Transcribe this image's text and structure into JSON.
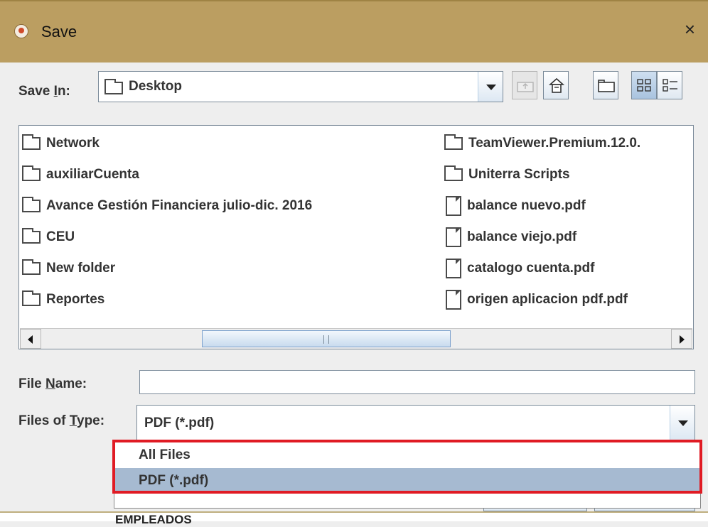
{
  "window": {
    "title": "Save",
    "close_glyph": "×"
  },
  "save_in": {
    "label_pre": "Save ",
    "label_mnemonic": "I",
    "label_post": "n:",
    "value": "Desktop"
  },
  "toolbar": {
    "buttons": [
      {
        "name": "up-one-level-icon",
        "enabled": false
      },
      {
        "name": "home-icon",
        "enabled": true
      },
      {
        "name": "new-folder-icon",
        "enabled": true
      },
      {
        "name": "list-view-icon",
        "enabled": true,
        "selected": true
      },
      {
        "name": "details-view-icon",
        "enabled": true
      }
    ]
  },
  "files": {
    "left_column": [
      {
        "type": "folder",
        "name": "Network"
      },
      {
        "type": "folder",
        "name": "auxiliarCuenta"
      },
      {
        "type": "folder",
        "name": "Avance Gestión Financiera julio-dic. 2016"
      },
      {
        "type": "folder",
        "name": "CEU"
      },
      {
        "type": "folder",
        "name": "New folder"
      },
      {
        "type": "folder",
        "name": "Reportes"
      }
    ],
    "right_column": [
      {
        "type": "folder",
        "name": "TeamViewer.Premium.12.0."
      },
      {
        "type": "folder",
        "name": "Uniterra Scripts"
      },
      {
        "type": "file",
        "name": "balance nuevo.pdf"
      },
      {
        "type": "file",
        "name": "balance viejo.pdf"
      },
      {
        "type": "file",
        "name": "catalogo cuenta.pdf"
      },
      {
        "type": "file",
        "name": "origen aplicacion pdf.pdf"
      }
    ]
  },
  "file_name": {
    "label_pre": "File ",
    "label_mnemonic": "N",
    "label_post": "ame:",
    "value": ""
  },
  "files_of_type": {
    "label_pre": "Files of ",
    "label_mnemonic": "T",
    "label_post": "ype:",
    "value": "PDF (*.pdf)",
    "options": [
      "All Files",
      "PDF (*.pdf)"
    ],
    "selected_index": 1
  },
  "partial_background_text": "EMPLEADOS",
  "colors": {
    "title_bar": "#bb9e61",
    "selection": "#a6bad1",
    "highlight_box": "#e01b24"
  }
}
